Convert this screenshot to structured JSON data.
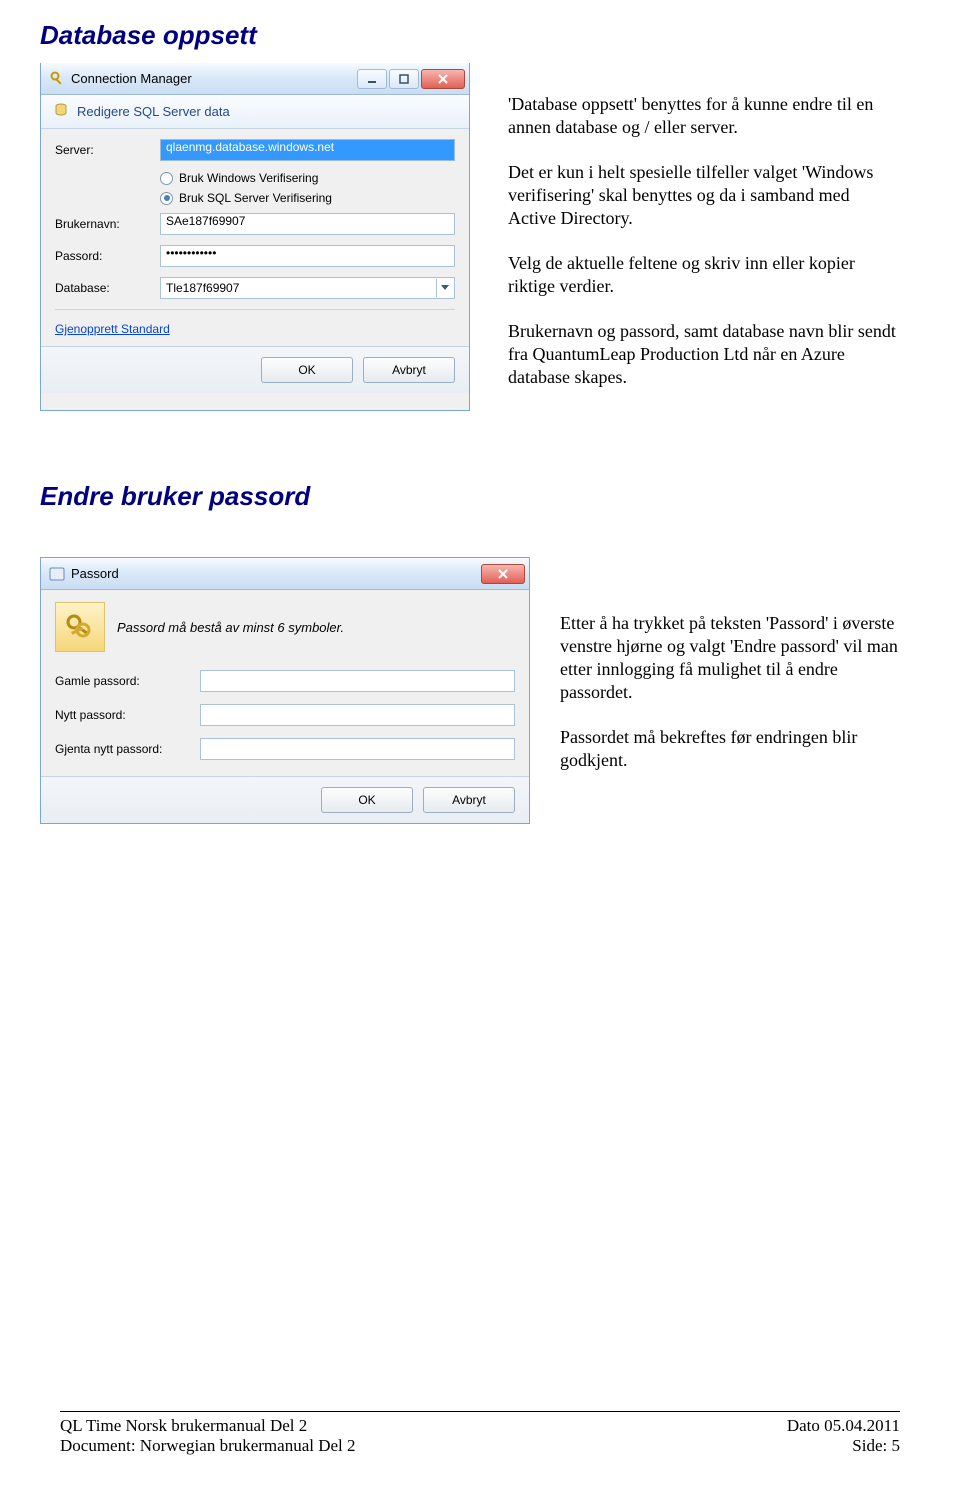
{
  "heading1": "Database oppsett",
  "heading2": "Endre bruker passord",
  "dialog1": {
    "title": "Connection Manager",
    "panelTitle": "Redigere SQL Server data",
    "labels": {
      "server": "Server:",
      "brukernavn": "Brukernavn:",
      "passord": "Passord:",
      "database": "Database:"
    },
    "values": {
      "server": "qlaenmg.database.windows.net",
      "brukernavn": "SAe187f69907",
      "passord": "••••••••••••",
      "database": "Tle187f69907"
    },
    "radio1": "Bruk Windows Verifisering",
    "radio2": "Bruk SQL Server Verifisering",
    "restoreLink": "Gjenopprett Standard",
    "ok": "OK",
    "cancel": "Avbryt"
  },
  "desc1": {
    "p1": "'Database oppsett' benyttes for å kunne endre til en annen database og / eller server.",
    "p2": "Det er kun i helt spesielle tilfeller valget 'Windows verifisering' skal benyttes og da i samband med Active Directory.",
    "p3": "Velg de aktuelle feltene og skriv inn eller kopier riktige verdier.",
    "p4": "Brukernavn og passord, samt database navn blir sendt fra QuantumLeap Production Ltd når en Azure database skapes."
  },
  "dialog2": {
    "title": "Passord",
    "msg": "Passord må bestå av minst 6 symboler.",
    "labels": {
      "old": "Gamle passord:",
      "new": "Nytt passord:",
      "repeat": "Gjenta nytt passord:"
    },
    "ok": "OK",
    "cancel": "Avbryt"
  },
  "desc2": {
    "p1": "Etter å ha trykket på teksten 'Passord' i øverste venstre hjørne og valgt 'Endre passord' vil man etter innlogging få mulighet til å endre passordet.",
    "p2": "Passordet må bekreftes før endringen blir godkjent."
  },
  "footer": {
    "l1": "QL Time Norsk brukermanual Del 2",
    "l2": "Document: Norwegian brukermanual Del 2",
    "r1": "Dato 05.04.2011",
    "r2": "Side: 5"
  }
}
